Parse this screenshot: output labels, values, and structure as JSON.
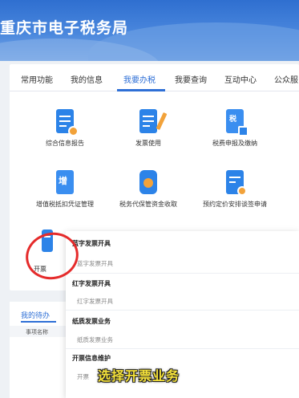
{
  "header": {
    "title": "重庆市电子税务局"
  },
  "tabs": [
    {
      "label": "常用功能",
      "active": false
    },
    {
      "label": "我的信息",
      "active": false
    },
    {
      "label": "我要办税",
      "active": true
    },
    {
      "label": "我要查询",
      "active": false
    },
    {
      "label": "互动中心",
      "active": false
    },
    {
      "label": "公众服",
      "active": false
    }
  ],
  "tiles": [
    {
      "label": "综合信息报告",
      "icon": "report-icon"
    },
    {
      "label": "发票使用",
      "icon": "invoice-pen-icon"
    },
    {
      "label": "税费申报及缴纳",
      "icon": "tax-declare-icon"
    },
    {
      "label": "增值税抵扣凭证管理",
      "icon": "vat-deduction-icon"
    },
    {
      "label": "税务代保管资金收取",
      "icon": "money-bag-icon"
    },
    {
      "label": "预约定价安排谈签申请",
      "icon": "pricing-icon"
    },
    {
      "label": "开票",
      "icon": "invoice-issue-icon"
    }
  ],
  "menu": {
    "sections": [
      {
        "title": "蓝字发票开具",
        "items": [
          "蓝字发票开具"
        ]
      },
      {
        "title": "红字发票开具",
        "items": [
          "红字发票开具"
        ]
      },
      {
        "title": "纸质发票业务",
        "items": [
          "纸质发票业务"
        ]
      },
      {
        "title": "开票信息维护",
        "items": [
          "开票"
        ]
      }
    ]
  },
  "todo": {
    "title": "我的待办",
    "column": "事项名称"
  },
  "caption": "选择开票业务",
  "colors": {
    "accent": "#2e6fd6",
    "annotation": "#e52b2b",
    "caption": "#f6e33a"
  }
}
